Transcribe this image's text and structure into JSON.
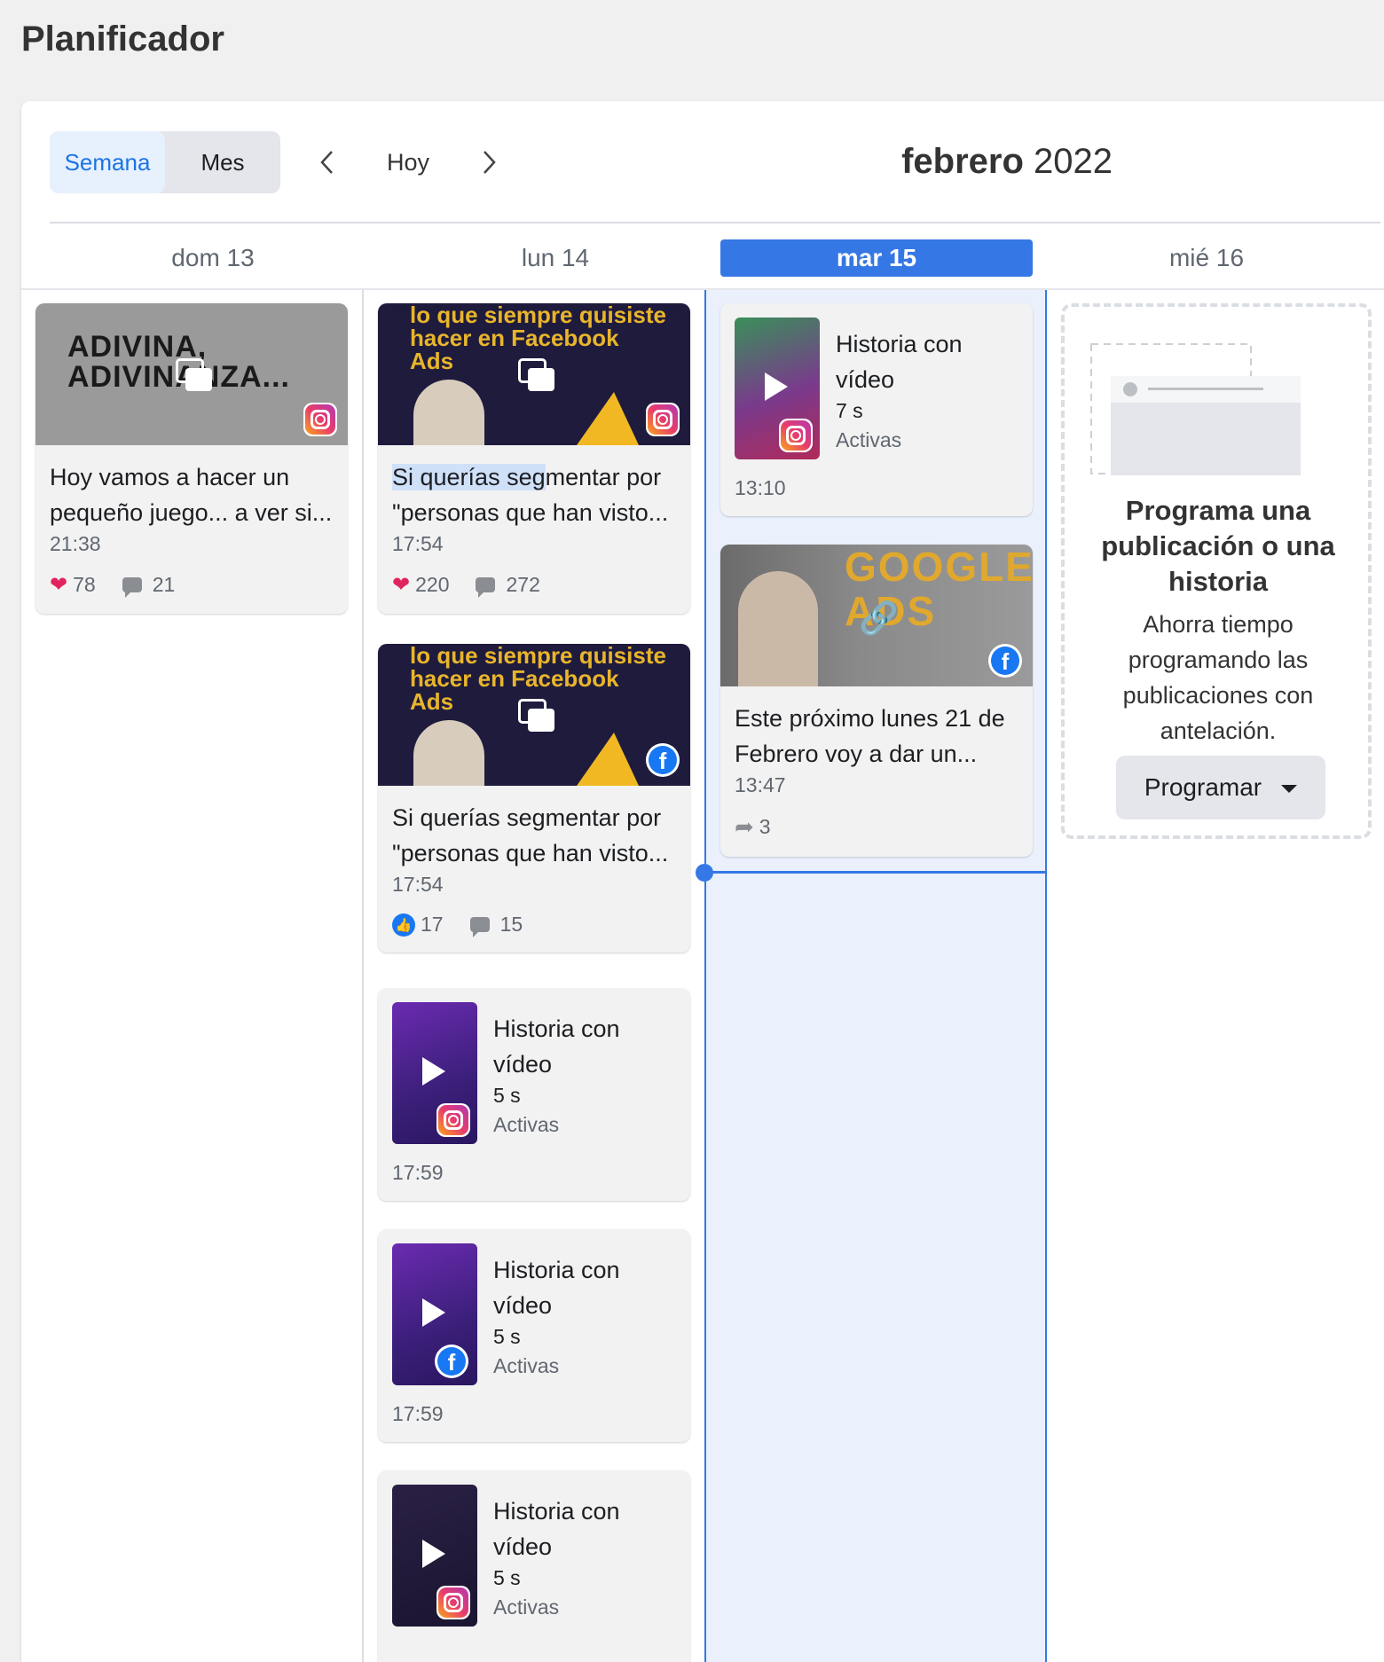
{
  "page": {
    "title": "Planificador"
  },
  "toolbar": {
    "week_label": "Semana",
    "month_label": "Mes",
    "today_label": "Hoy",
    "prev_icon": "chevron-left-icon",
    "next_icon": "chevron-right-icon",
    "month": "febrero",
    "year": "2022"
  },
  "days": [
    {
      "label": "dom 13"
    },
    {
      "label": "lun 14"
    },
    {
      "label": "mar 15",
      "active": true
    },
    {
      "label": "mié 16"
    }
  ],
  "posts": {
    "sun_1": {
      "thumb_text": "ADIVINA, ADIVINANZA...",
      "platform": "instagram",
      "caption_line1": "Hoy vamos a hacer un",
      "caption_line2": "pequeño juego... a ver si...",
      "time": "21:38",
      "likes": "78",
      "comments": "21"
    },
    "mon_1": {
      "thumb_text": "lo que siempre quisiste hacer en Facebook Ads",
      "platform": "instagram",
      "caption_hl": "Si querías seg",
      "caption_rest": "mentar por",
      "caption_line2": "\"personas que han visto...",
      "time": "17:54",
      "likes": "220",
      "comments": "272"
    },
    "mon_2": {
      "thumb_text": "lo que siempre quisiste hacer en Facebook Ads",
      "platform": "facebook",
      "caption_line1": "Si querías segmentar por",
      "caption_line2": "\"personas que han visto...",
      "time": "17:54",
      "likes": "17",
      "comments": "15"
    },
    "tue_2": {
      "thumb_text": "GOOGLE ADS",
      "platform": "facebook",
      "caption_line1": "Este próximo lunes 21 de",
      "caption_line2": "Febrero voy a dar un...",
      "time": "13:47",
      "shares": "3"
    }
  },
  "stories": {
    "tue_1": {
      "title1": "Historia con",
      "title2": "vídeo",
      "duration": "7 s",
      "status": "Activas",
      "time": "13:10",
      "platform": "instagram"
    },
    "mon_3": {
      "title1": "Historia con",
      "title2": "vídeo",
      "duration": "5 s",
      "status": "Activas",
      "time": "17:59",
      "platform": "instagram"
    },
    "mon_4": {
      "title1": "Historia con",
      "title2": "vídeo",
      "duration": "5 s",
      "status": "Activas",
      "time": "17:59",
      "platform": "facebook"
    },
    "mon_5": {
      "title1": "Historia con",
      "title2": "vídeo",
      "duration": "5 s",
      "status": "Activas",
      "platform": "instagram"
    }
  },
  "empty_state": {
    "title_line1": "Programa una",
    "title_line2": "publicación o una",
    "title_line3": "historia",
    "desc_line1": "Ahorra tiempo",
    "desc_line2": "programando las",
    "desc_line3": "publicaciones con",
    "desc_line4": "antelación.",
    "button_label": "Programar"
  },
  "colors": {
    "accent": "#3578e5",
    "today_bg": "#eaf1fd",
    "facebook": "#1877f2"
  }
}
